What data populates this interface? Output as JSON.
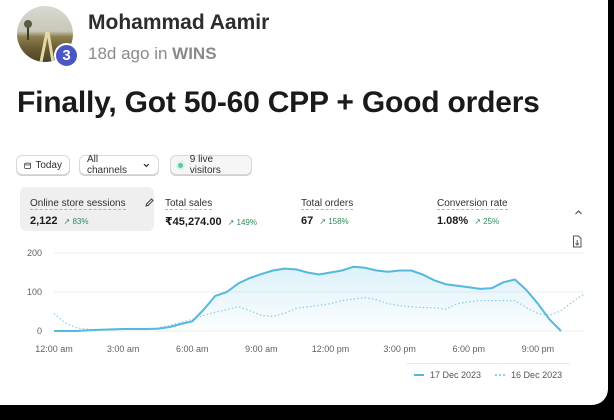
{
  "post": {
    "author": "Mohammad Aamir",
    "level": "3",
    "time_ago": "18d ago",
    "in_word": "in",
    "group": "WINS",
    "title": "Finally, Got 50-60 CPP + Good orders"
  },
  "dashboard": {
    "date_button": "Today",
    "channels_button": "All channels",
    "live_visitors": "9 live visitors",
    "metrics": [
      {
        "label": "Online store sessions",
        "value": "2,122",
        "change": "83%"
      },
      {
        "label": "Total sales",
        "value": "₹45,274.00",
        "change": "149%"
      },
      {
        "label": "Total orders",
        "value": "67",
        "change": "158%"
      },
      {
        "label": "Conversion rate",
        "value": "1.08%",
        "change": "25%"
      }
    ],
    "colors": {
      "series_current": "#55b8de",
      "series_previous": "#8fd0e6",
      "positive": "#2f8a5b"
    },
    "icons": [
      "calendar-icon",
      "chevron-down-icon",
      "pencil-icon",
      "chevron-up-icon",
      "export-icon"
    ]
  },
  "chart_data": {
    "type": "area",
    "x_ticks": [
      "12:00 am",
      "3:00 am",
      "6:00 am",
      "9:00 am",
      "12:00 pm",
      "3:00 pm",
      "6:00 pm",
      "9:00 pm"
    ],
    "y_ticks": [
      "200",
      "100",
      "0"
    ],
    "ylim": [
      0,
      200
    ],
    "xlim": [
      0,
      23
    ],
    "grid": true,
    "legend": "bottom-right",
    "series": [
      {
        "name": "17 Dec 2023",
        "style": "solid",
        "x": [
          0,
          0.5,
          1,
          1.5,
          2,
          2.5,
          3,
          3.5,
          4,
          4.5,
          5,
          5.5,
          6,
          6.5,
          7,
          7.5,
          8,
          8.5,
          9,
          9.5,
          10,
          10.5,
          11,
          11.5,
          12,
          12.5,
          13,
          13.5,
          14,
          14.5,
          15,
          15.5,
          16,
          16.5,
          17,
          17.5,
          18,
          18.5,
          19,
          19.5,
          20,
          20.5,
          21,
          21.5,
          22
        ],
        "values": [
          0,
          0,
          0,
          2,
          3,
          4,
          5,
          5,
          5,
          6,
          10,
          18,
          25,
          55,
          90,
          100,
          122,
          136,
          146,
          155,
          160,
          158,
          150,
          145,
          150,
          155,
          165,
          162,
          155,
          152,
          155,
          155,
          145,
          130,
          120,
          116,
          112,
          108,
          110,
          125,
          132,
          105,
          70,
          30,
          0
        ]
      },
      {
        "name": "16 Dec 2023",
        "style": "dotted",
        "x": [
          0,
          0.5,
          1,
          1.5,
          2,
          2.5,
          3,
          3.5,
          4,
          4.5,
          5,
          5.5,
          6,
          6.5,
          7,
          7.5,
          8,
          8.5,
          9,
          9.5,
          10,
          10.5,
          11,
          11.5,
          12,
          12.5,
          13,
          13.5,
          14,
          14.5,
          15,
          15.5,
          16,
          16.5,
          17,
          17.5,
          18,
          18.5,
          19,
          19.5,
          20,
          20.5,
          21,
          21.5,
          22,
          22.5,
          23
        ],
        "values": [
          45,
          20,
          8,
          4,
          3,
          3,
          4,
          5,
          6,
          8,
          14,
          22,
          30,
          40,
          48,
          55,
          62,
          52,
          40,
          38,
          45,
          58,
          62,
          66,
          70,
          78,
          82,
          86,
          80,
          70,
          65,
          62,
          60,
          60,
          56,
          70,
          75,
          78,
          78,
          78,
          78,
          60,
          45,
          40,
          52,
          75,
          95
        ]
      }
    ]
  }
}
